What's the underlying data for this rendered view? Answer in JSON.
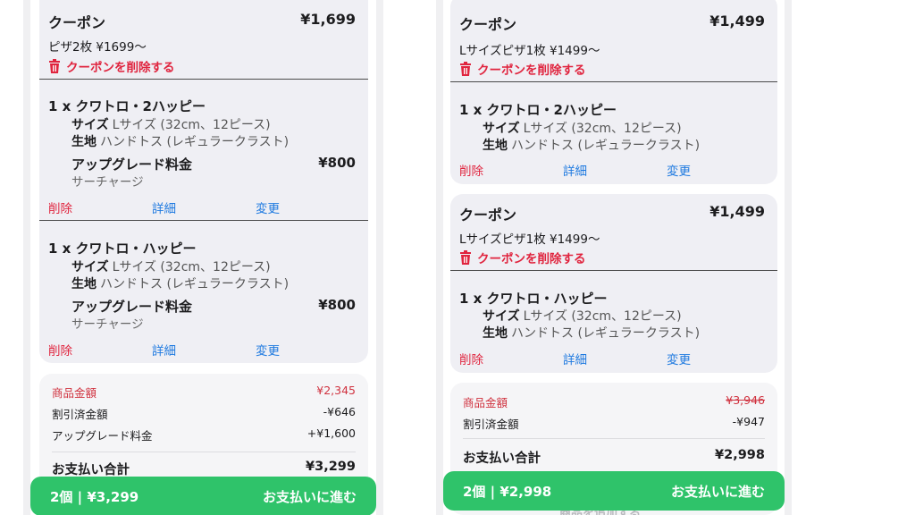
{
  "left": {
    "coupon": {
      "title": "クーポン",
      "price": "¥1,699",
      "description": "ピザ2枚 ¥1699〜",
      "remove_label": "クーポンを削除する"
    },
    "items": [
      {
        "name": "1 x クワトロ・2ハッピー",
        "size_label": "サイズ",
        "size_value": "Lサイズ (32cm、12ピース)",
        "crust_label": "生地",
        "crust_value": "ハンドトス (レギュラークラスト)",
        "upgrade_label": "アップグレード料金",
        "upgrade_price": "¥800",
        "upgrade_sub": "サーチャージ",
        "delete_label": "削除",
        "detail_label": "詳細",
        "change_label": "変更"
      },
      {
        "name": "1 x クワトロ・ハッピー",
        "size_label": "サイズ",
        "size_value": "Lサイズ (32cm、12ピース)",
        "crust_label": "生地",
        "crust_value": "ハンドトス (レギュラークラスト)",
        "upgrade_label": "アップグレード料金",
        "upgrade_price": "¥800",
        "upgrade_sub": "サーチャージ",
        "delete_label": "削除",
        "detail_label": "詳細",
        "change_label": "変更"
      }
    ],
    "summary": {
      "subtotal_label": "商品金額",
      "subtotal_value": "¥2,345",
      "discount_label": "割引済金額",
      "discount_value": "-¥646",
      "upgrade_label": "アップグレード料金",
      "upgrade_value": "+¥1,600",
      "total_label": "お支払い合計",
      "total_value": "¥3,299"
    },
    "pay_button": {
      "count_total": "2個 | ¥3,299",
      "label": "お支払いに進む"
    }
  },
  "right": {
    "coupons": [
      {
        "title": "クーポン",
        "price": "¥1,499",
        "description": "Lサイズピザ1枚 ¥1499〜",
        "remove_label": "クーポンを削除する",
        "item": {
          "name": "1 x クワトロ・2ハッピー",
          "size_label": "サイズ",
          "size_value": "Lサイズ (32cm、12ピース)",
          "crust_label": "生地",
          "crust_value": "ハンドトス (レギュラークラスト)",
          "delete_label": "削除",
          "detail_label": "詳細",
          "change_label": "変更"
        }
      },
      {
        "title": "クーポン",
        "price": "¥1,499",
        "description": "Lサイズピザ1枚 ¥1499〜",
        "remove_label": "クーポンを削除する",
        "item": {
          "name": "1 x クワトロ・ハッピー",
          "size_label": "サイズ",
          "size_value": "Lサイズ (32cm、12ピース)",
          "crust_label": "生地",
          "crust_value": "ハンドトス (レギュラークラスト)",
          "delete_label": "削除",
          "detail_label": "詳細",
          "change_label": "変更"
        }
      }
    ],
    "summary": {
      "subtotal_label": "商品金額",
      "subtotal_value": "¥3,946",
      "discount_label": "割引済金額",
      "discount_value": "-¥947",
      "total_label": "お支払い合計",
      "total_value": "¥2,998"
    },
    "pay_button": {
      "count_total": "2個 | ¥2,998",
      "label": "お支払いに進む"
    },
    "under_button_text": "商品を追加する"
  },
  "colors": {
    "accent_red": "#e0243e",
    "link_blue": "#1f7ae0",
    "pay_green": "#2fc36a"
  }
}
